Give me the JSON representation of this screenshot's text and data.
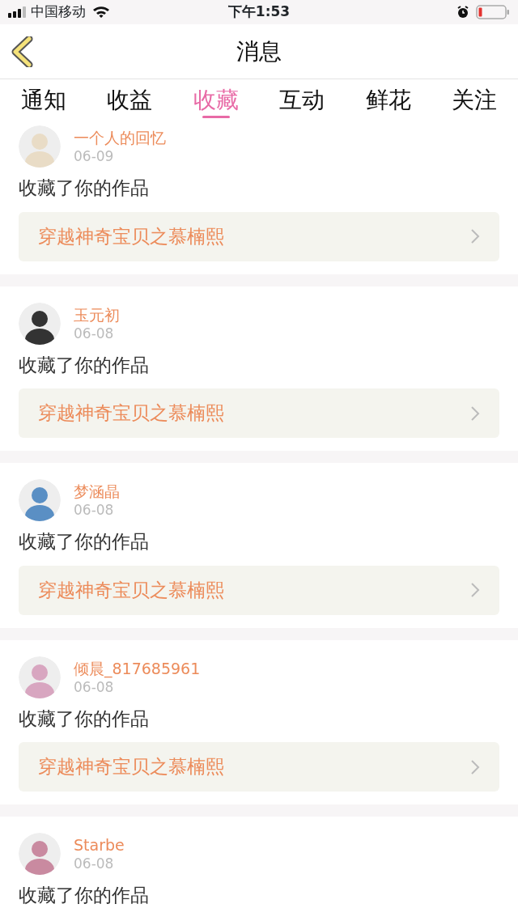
{
  "status_bar": {
    "carrier": "中国移动",
    "time": "下午1:53"
  },
  "header": {
    "title": "消息"
  },
  "tabs": [
    {
      "label": "通知",
      "selected": false
    },
    {
      "label": "收益",
      "selected": false
    },
    {
      "label": "收藏",
      "selected": true
    },
    {
      "label": "互动",
      "selected": false
    },
    {
      "label": "鲜花",
      "selected": false
    },
    {
      "label": "关注",
      "selected": false
    }
  ],
  "messages": [
    {
      "user": "一个人的回忆",
      "date": "06-09",
      "text": "收藏了你的作品",
      "work": "穿越神奇宝贝之慕楠熙"
    },
    {
      "user": "玉元初",
      "date": "06-08",
      "text": "收藏了你的作品",
      "work": "穿越神奇宝贝之慕楠熙"
    },
    {
      "user": "梦涵晶",
      "date": "06-08",
      "text": "收藏了你的作品",
      "work": "穿越神奇宝贝之慕楠熙"
    },
    {
      "user": "倾晨_817685961",
      "date": "06-08",
      "text": "收藏了你的作品",
      "work": "穿越神奇宝贝之慕楠熙"
    },
    {
      "user": "Starbe",
      "date": "06-08",
      "text": "收藏了你的作品"
    }
  ]
}
